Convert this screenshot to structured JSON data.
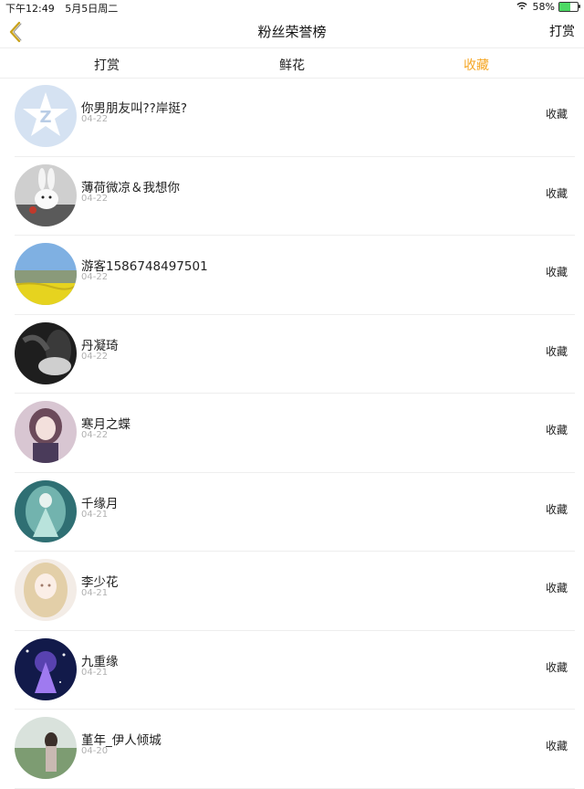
{
  "status": {
    "time": "下午12:49",
    "date": "5月5日周二",
    "battery": "58%",
    "battery_level": 0.58
  },
  "nav": {
    "title": "粉丝荣誉榜",
    "right_label": "打赏",
    "back_icon": "chevron-left-icon"
  },
  "tabs": [
    {
      "label": "打赏",
      "active": false
    },
    {
      "label": "鲜花",
      "active": false
    },
    {
      "label": "收藏",
      "active": true
    }
  ],
  "colors": {
    "accent": "#f5a623"
  },
  "rows": [
    {
      "name": "你男朋友叫??岸挺?",
      "date": "04-22",
      "action": "收藏",
      "avatar": "qq-default-avatar"
    },
    {
      "name": "薄荷微凉＆我想你",
      "date": "04-22",
      "action": "收藏",
      "avatar": "rabbit-avatar"
    },
    {
      "name": "游客1586748497501",
      "date": "04-22",
      "action": "收藏",
      "avatar": "landscape-avatar"
    },
    {
      "name": "丹凝琦",
      "date": "04-22",
      "action": "收藏",
      "avatar": "dark-portrait-avatar"
    },
    {
      "name": "寒月之蝶",
      "date": "04-22",
      "action": "收藏",
      "avatar": "anime-girl-avatar"
    },
    {
      "name": "千缘月",
      "date": "04-21",
      "action": "收藏",
      "avatar": "teal-fairy-avatar"
    },
    {
      "name": "李少花",
      "date": "04-21",
      "action": "收藏",
      "avatar": "blonde-anime-avatar"
    },
    {
      "name": "九重缘",
      "date": "04-21",
      "action": "收藏",
      "avatar": "purple-night-avatar"
    },
    {
      "name": "堇年_伊人倾城",
      "date": "04-20",
      "action": "收藏",
      "avatar": "field-girl-avatar"
    }
  ]
}
